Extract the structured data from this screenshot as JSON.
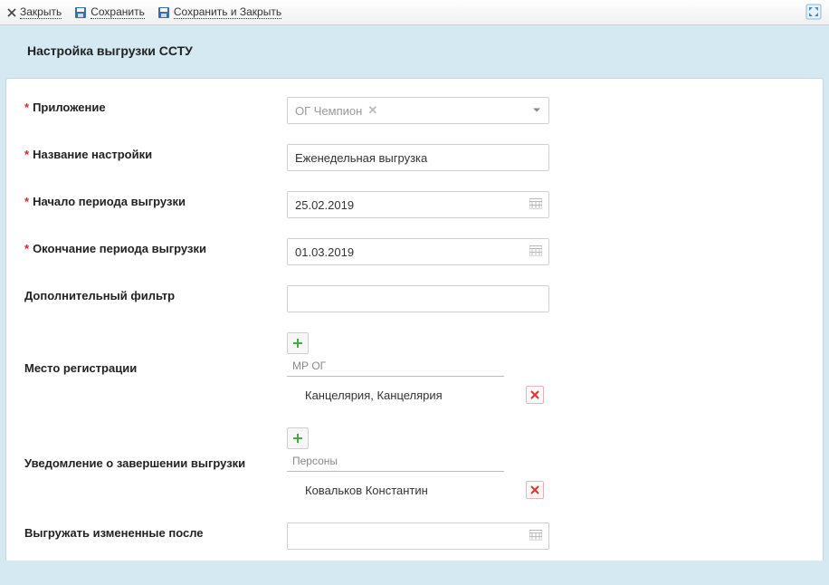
{
  "toolbar": {
    "close": "Закрыть",
    "save": "Сохранить",
    "save_close": "Сохранить и Закрыть"
  },
  "page_title": "Настройка выгрузки ССТУ",
  "fields": {
    "app": {
      "label": "Приложение",
      "value": "ОГ Чемпион"
    },
    "name": {
      "label": "Название настройки",
      "value": "Еженедельная выгрузка"
    },
    "start": {
      "label": "Начало периода выгрузки",
      "value": "25.02.2019"
    },
    "end": {
      "label": "Окончание периода выгрузки",
      "value": "01.03.2019"
    },
    "filter": {
      "label": "Дополнительный фильтр",
      "value": ""
    },
    "reg_place": {
      "label": "Место регистрации",
      "sub_header": "МР ОГ",
      "items": [
        "Канцелярия, Канцелярия"
      ]
    },
    "notify": {
      "label": "Уведомление о завершении выгрузки",
      "sub_header": "Персоны",
      "items": [
        "Ковальков Константин"
      ]
    },
    "changed_after": {
      "label": "Выгружать измененные после",
      "value": ""
    }
  }
}
